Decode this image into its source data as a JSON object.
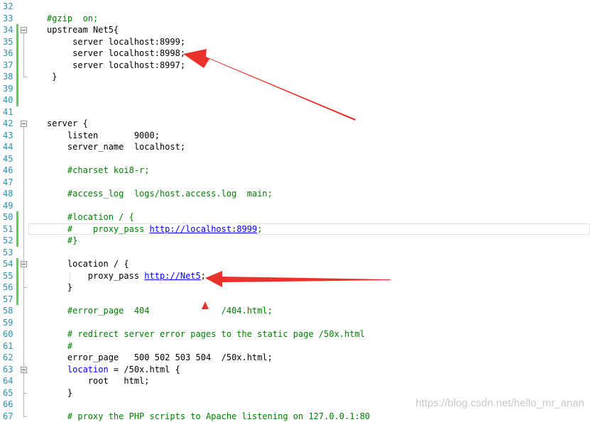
{
  "editor": {
    "lines": [
      {
        "n": "32",
        "text": ""
      },
      {
        "n": "33",
        "text": "#gzip  on;",
        "cls": "cm"
      },
      {
        "n": "34",
        "text": "upstream Net5{"
      },
      {
        "n": "35",
        "text": "     server localhost:8999;"
      },
      {
        "n": "36",
        "text": "     server localhost:8998;"
      },
      {
        "n": "37",
        "text": "     server localhost:8997;"
      },
      {
        "n": "38",
        "text": " }"
      },
      {
        "n": "39",
        "text": ""
      },
      {
        "n": "40",
        "text": ""
      },
      {
        "n": "41",
        "text": ""
      },
      {
        "n": "42",
        "text": "server {"
      },
      {
        "n": "43",
        "text": "    listen       9000;"
      },
      {
        "n": "44",
        "text": "    server_name  localhost;"
      },
      {
        "n": "45",
        "text": ""
      },
      {
        "n": "46",
        "text": "    #charset koi8-r;",
        "cls": "cm"
      },
      {
        "n": "47",
        "text": ""
      },
      {
        "n": "48",
        "text": "    #access_log  logs/host.access.log  main;",
        "cls": "cm"
      },
      {
        "n": "49",
        "text": ""
      },
      {
        "n": "50",
        "text": "    #location / {",
        "cls": "cm"
      },
      {
        "n": "51",
        "prefix": "    #    proxy_pass ",
        "url": "http://localhost:8999",
        "suffix": ";",
        "cls": "cm"
      },
      {
        "n": "52",
        "text": "    #}",
        "cls": "cm"
      },
      {
        "n": "53",
        "text": ""
      },
      {
        "n": "54",
        "text": "    location / {"
      },
      {
        "n": "55",
        "prefix": "        proxy_pass ",
        "url": "http://Net5",
        "suffix": ";"
      },
      {
        "n": "56",
        "text": "    }"
      },
      {
        "n": "57",
        "text": ""
      },
      {
        "n": "58",
        "text": "    #error_page  404              /404.html;",
        "cls": "cm"
      },
      {
        "n": "59",
        "text": ""
      },
      {
        "n": "60",
        "text": "    # redirect server error pages to the static page /50x.html",
        "cls": "cm"
      },
      {
        "n": "61",
        "text": "    #",
        "cls": "cm"
      },
      {
        "n": "62",
        "text": "    error_page   500 502 503 504  /50x.html;"
      },
      {
        "n": "63",
        "kw": "    location",
        "rest": " = /50x.html {"
      },
      {
        "n": "64",
        "text": "        root   html;"
      },
      {
        "n": "65",
        "text": "    }"
      },
      {
        "n": "66",
        "text": ""
      },
      {
        "n": "67",
        "text": "    # proxy the PHP scripts to Apache listening on 127.0.0.1:80",
        "cls": "cm"
      }
    ],
    "changed_lines": [
      "34",
      "35",
      "36",
      "37",
      "38",
      "39",
      "40",
      "50",
      "51",
      "52",
      "54",
      "55",
      "56",
      "57"
    ],
    "fold_markers": [
      "34",
      "42",
      "54",
      "63"
    ],
    "current_line": "51"
  },
  "colors": {
    "line_number": "#2b91af",
    "comment": "#008000",
    "keyword": "#0000ff",
    "change_bar": "#6cc36c",
    "arrow": "#e8322b"
  },
  "watermark": "https://blog.csdn.net/hello_mr_anan"
}
